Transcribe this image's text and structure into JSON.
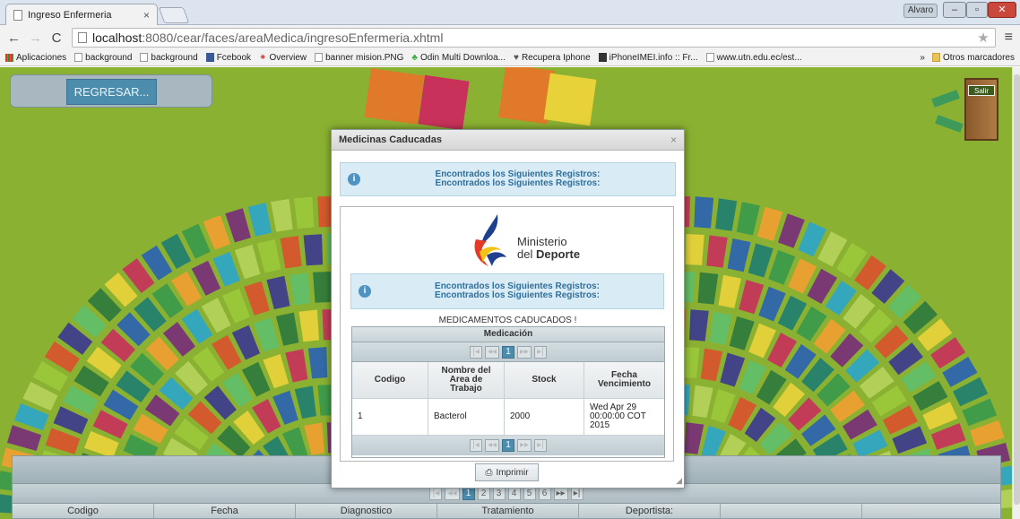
{
  "browser": {
    "tab_title": "Ingreso Enfermeria",
    "tab_close": "×",
    "user_label": "Alvaro",
    "url_host": "localhost",
    "url_path": ":8080/cear/faces/areaMedica/ingresoEnfermeria.xhtml",
    "bookmarks": [
      "Aplicaciones",
      "background",
      "background",
      "Fcebook",
      "Overview",
      "banner mision.PNG",
      "Odin Multi Downloa...",
      "Recupera Iphone",
      "iPhoneIMEI.info :: Fr...",
      "www.utn.edu.ec/est..."
    ],
    "bookmarks_more": "»",
    "other_bookmarks": "Otros marcadores"
  },
  "page": {
    "back_button": "REGRESAR...",
    "exit_label": "Salir"
  },
  "bottom_grid": {
    "pages": [
      "1",
      "2",
      "3",
      "4",
      "5",
      "6"
    ],
    "current_page": "1",
    "columns": [
      "Codigo",
      "Fecha",
      "Diagnostico",
      "Tratamiento",
      "Deportista:",
      "",
      ""
    ]
  },
  "dialog": {
    "title": "Medicinas Caducadas",
    "close": "×",
    "message_line1": "Encontrados los Siguientes Registros:",
    "message_line2": "Encontrados los Siguientes Registros:",
    "logo_line1": "Ministerio",
    "logo_line2_a": "del ",
    "logo_line2_b": "Deporte",
    "inner_message_line1": "Encontrados los Siguientes Registros:",
    "inner_message_line2": "Encontrados los Siguientes Registros:",
    "table_title": "MEDICAMENTOS CADUCADOS !",
    "table_caption": "Medicación",
    "pager_current": "1",
    "columns": [
      "Codigo",
      "Nombre del Area de Trabajo",
      "Stock",
      "Fecha Vencimiento"
    ],
    "rows": [
      {
        "codigo": "1",
        "nombre": "Bacterol",
        "stock": "2000",
        "fecha": "Wed Apr 29 00:00:00 COT 2015"
      }
    ],
    "print_button": "Imprimir"
  }
}
